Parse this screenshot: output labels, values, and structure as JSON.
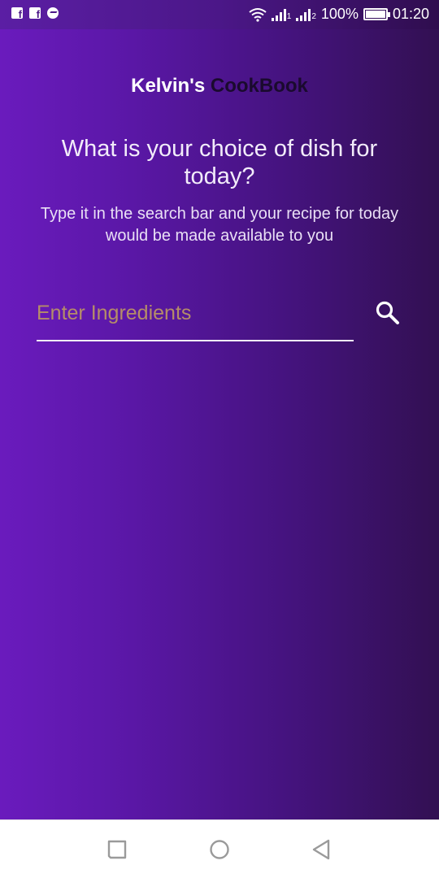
{
  "status_bar": {
    "notification_icons": [
      "facebook-icon",
      "facebook-icon",
      "messenger-icon"
    ],
    "sim1_label": "1",
    "sim2_label": "2",
    "battery": "100%",
    "time": "01:20"
  },
  "header": {
    "title_part1": "Kelvin's",
    "title_part2": "CookBook"
  },
  "main": {
    "headline": "What is your choice of dish for today?",
    "subtext": "Type it in the search bar and your recipe for today would be made available to you"
  },
  "search": {
    "placeholder": "Enter Ingredients",
    "value": "",
    "icon": "search-icon"
  },
  "nav_bar": {
    "items": [
      "recent-apps-icon",
      "home-icon",
      "back-icon"
    ]
  },
  "colors": {
    "gradient_start": "#6a1bbd",
    "gradient_end": "#321052",
    "title_accent": "#1a0a2e",
    "placeholder": "#b58d68"
  }
}
